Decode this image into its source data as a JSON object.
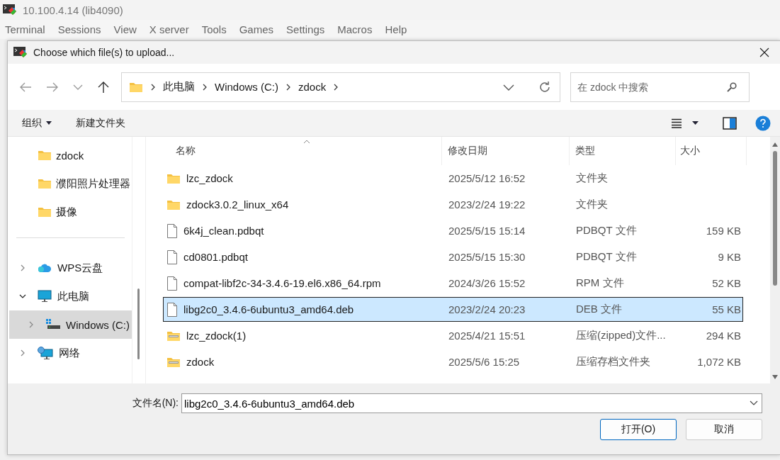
{
  "app": {
    "title": "10.100.4.14 (lib4090)",
    "menu": [
      "Terminal",
      "Sessions",
      "View",
      "X server",
      "Tools",
      "Games",
      "Settings",
      "Macros",
      "Help"
    ]
  },
  "dialog": {
    "title": "Choose which file(s) to upload...",
    "path": [
      "此电脑",
      "Windows (C:)",
      "zdock"
    ],
    "search": {
      "placeholder": "在 zdock 中搜索"
    },
    "commands": [
      "组织",
      "新建文件夹"
    ],
    "quick_access": [
      "zdock",
      "濮阳照片处理器",
      "摄像"
    ],
    "tree": [
      {
        "label": "WPS云盘",
        "kind": "cloud",
        "expanded": false,
        "selected": false
      },
      {
        "label": "此电脑",
        "kind": "computer",
        "expanded": true,
        "selected": false,
        "children": [
          {
            "label": "Windows (C:)",
            "kind": "drive",
            "expanded": false,
            "selected": true
          }
        ]
      },
      {
        "label": "网络",
        "kind": "network",
        "expanded": false,
        "selected": false
      }
    ],
    "columns": [
      "名称",
      "修改日期",
      "类型",
      "大小"
    ],
    "files": [
      {
        "name": "lzc_zdock",
        "date": "2025/5/12 16:52",
        "type": "文件夹",
        "kind": "folder",
        "selected": false
      },
      {
        "name": "zdock3.0.2_linux_x64",
        "date": "2023/2/24 19:22",
        "type": "文件夹",
        "kind": "folder",
        "selected": false
      },
      {
        "name": "6k4j_clean.pdbqt",
        "date": "2025/5/15 15:14",
        "type": "PDBQT 文件",
        "size": "159 KB",
        "kind": "file",
        "selected": false
      },
      {
        "name": "cd0801.pdbqt",
        "date": "2025/5/15 15:30",
        "type": "PDBQT 文件",
        "size": "9 KB",
        "kind": "file",
        "selected": false
      },
      {
        "name": "compat-libf2c-34-3.4.6-19.el6.x86_64.rpm",
        "date": "2024/3/26 15:52",
        "type": "RPM 文件",
        "size": "52 KB",
        "kind": "file",
        "selected": false
      },
      {
        "name": "libg2c0_3.4.6-6ubuntu3_amd64.deb",
        "date": "2023/2/24 20:23",
        "type": "DEB 文件",
        "size": "55 KB",
        "kind": "file",
        "selected": true
      },
      {
        "name": "lzc_zdock(1)",
        "date": "2025/4/21 15:51",
        "type": "压缩(zipped)文件...",
        "size": "294 KB",
        "kind": "zip",
        "selected": false
      },
      {
        "name": "zdock",
        "date": "2025/5/6 15:25",
        "type": "压缩存档文件夹",
        "size": "1,072 KB",
        "kind": "zip",
        "selected": false
      }
    ],
    "filename_label": "文件名(N):",
    "filename": "libg2c0_3.4.6-6ubuntu3_amd64.deb",
    "buttons": [
      "打开(O)",
      "取消"
    ]
  }
}
